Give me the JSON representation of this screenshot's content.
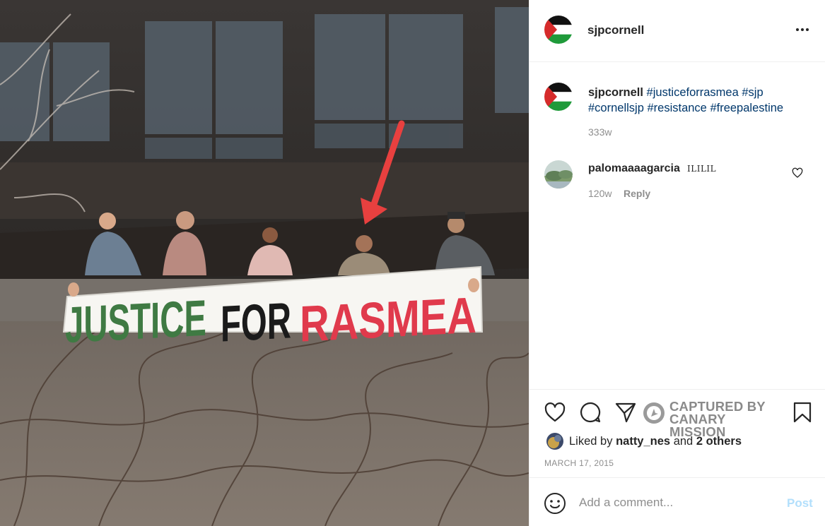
{
  "post": {
    "photo_alt": "",
    "banner_text": [
      "JUSTICE",
      "FOR",
      "RASMEA"
    ],
    "banner_colors": {
      "justice": "#3f7a43",
      "for": "#1b1b1b",
      "rasmea": "#e03a4c"
    },
    "arrow_color": "#e8403f"
  },
  "header": {
    "username": "sjpcornell"
  },
  "caption": {
    "username": "sjpcornell",
    "hashtags": [
      "#justiceforrasmea",
      "#sjp",
      "#cornellsjp",
      "#resistance",
      "#freepalestine"
    ],
    "time": "333w"
  },
  "comments": [
    {
      "username": "palomaaaagarcia",
      "text": "ILILIL",
      "time": "120w",
      "reply_label": "Reply"
    }
  ],
  "watermark": {
    "line1": "CAPTURED BY",
    "line2": "CANARY MISSION"
  },
  "likes": {
    "prefix": "Liked by",
    "user": "natty_nes",
    "conj": "and",
    "others": "2 others"
  },
  "date": "MARCH 17, 2015",
  "add_comment": {
    "placeholder": "Add a comment...",
    "post_label": "Post"
  },
  "colors": {
    "link": "#00376b",
    "muted": "#8e8e8e",
    "post_disabled": "#b2dffc",
    "text": "#262626"
  },
  "icons": [
    "more-options-icon",
    "heart-icon",
    "comment-icon",
    "share-icon",
    "bookmark-icon",
    "emoji-icon",
    "canary-mission-logo-icon"
  ]
}
